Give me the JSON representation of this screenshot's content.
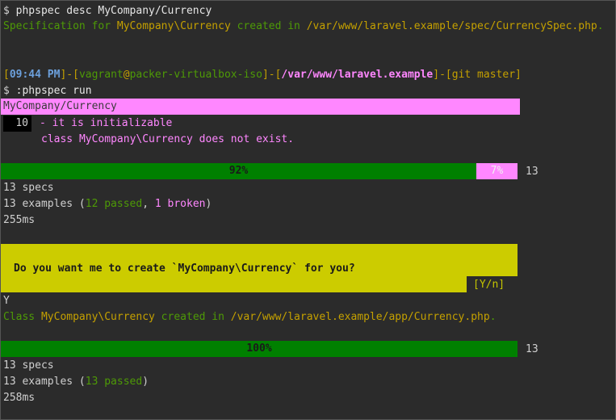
{
  "line1": {
    "prompt": "$ ",
    "cmd": "phpspec desc MyCompany/Currency"
  },
  "line2": {
    "a": "Specification for ",
    "b": "MyCompany\\Currency",
    "c": " created in ",
    "d": "/var/www/laravel.example/spec/CurrencySpec.php",
    "e": "."
  },
  "prompt": {
    "lb1": "[",
    "time": "09:44 PM",
    "rb1": "]",
    "dash1": "-",
    "lb2": "[",
    "user": "vagrant",
    "at": "@",
    "host": "packer-virtualbox-iso",
    "rb2": "]",
    "dash2": "-",
    "lb3": "[",
    "path": "/var/www/laravel.example",
    "rb3": "]",
    "dash3": "-",
    "git": "[git master]"
  },
  "run": {
    "prompt": "$ ",
    "cmd": ":phpspec run"
  },
  "spec_header": "MyCompany/Currency",
  "example": {
    "line_no": "10",
    "title": "- it is initializable",
    "error": "class MyCompany\\Currency does not exist."
  },
  "progress1": {
    "passed_pct_label": "92%",
    "broken_pct_label": "7%",
    "total": "13",
    "passed_fraction": 0.92,
    "broken_fraction": 0.08
  },
  "summary1": {
    "specs": "13 specs",
    "ex_prefix": "13 examples (",
    "passed": "12 passed",
    "sep": ", ",
    "broken": "1 broken",
    "ex_suffix": ")",
    "time": "255ms"
  },
  "question": {
    "text": "Do you want me to create `MyCompany\\Currency` for you?",
    "choices": "[Y/n]"
  },
  "answer": "Y",
  "created": {
    "a": "Class ",
    "b": "MyCompany\\Currency",
    "c": " created in ",
    "d": "/var/www/laravel.example/app/Currency.php",
    "e": "."
  },
  "progress2": {
    "label": "100%",
    "total": "13",
    "passed_fraction": 1.0
  },
  "summary2": {
    "specs": "13 specs",
    "ex_prefix": "13 examples (",
    "passed": "13 passed",
    "ex_suffix": ")",
    "time": "258ms"
  },
  "colors": {
    "background": "#2b2b2b",
    "green": "#4e9a06",
    "bar_green": "#008000",
    "pink": "#ff87ff",
    "yellow": "#cccc00"
  }
}
